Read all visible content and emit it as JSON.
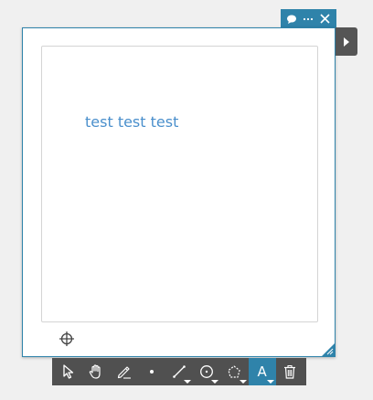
{
  "header": {
    "icons": [
      "comment-icon",
      "more-icon",
      "close-icon"
    ]
  },
  "canvas": {
    "text": "test test test",
    "text_color": "#4a8fcc"
  },
  "toolbar": {
    "tools": [
      {
        "name": "select-tool",
        "icon": "arrow-pointer-icon"
      },
      {
        "name": "pan-tool",
        "icon": "hand-icon"
      },
      {
        "name": "draw-tool",
        "icon": "pen-icon"
      },
      {
        "name": "point-tool",
        "icon": "dot-icon"
      },
      {
        "name": "line-tool",
        "icon": "line-icon",
        "has_dropdown": true
      },
      {
        "name": "circle-tool",
        "icon": "circle-icon",
        "has_dropdown": true
      },
      {
        "name": "polygon-tool",
        "icon": "polygon-icon",
        "has_dropdown": true
      },
      {
        "name": "text-tool",
        "icon": "text-icon",
        "label": "A",
        "active": true,
        "has_dropdown": true
      },
      {
        "name": "delete-tool",
        "icon": "trash-icon"
      }
    ]
  },
  "colors": {
    "accent": "#2f83aa",
    "toolbar_bg": "#505050",
    "side_tab_bg": "#555555",
    "background": "#f0f0f0"
  }
}
